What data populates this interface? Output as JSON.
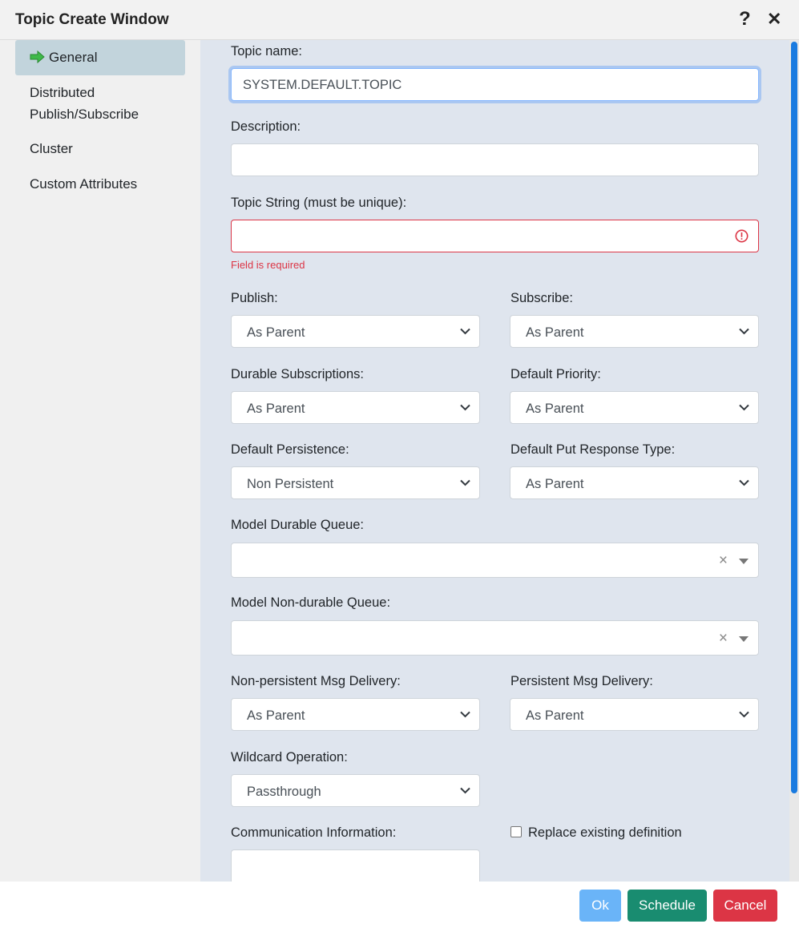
{
  "window": {
    "title": "Topic Create Window"
  },
  "sidebar": {
    "items": [
      {
        "label": "General"
      },
      {
        "label_line1": "Distributed",
        "label_line2": "Publish/Subscribe"
      },
      {
        "label": "Cluster"
      },
      {
        "label": "Custom Attributes"
      }
    ]
  },
  "form": {
    "topic_name": {
      "label": "Topic name:",
      "value": "SYSTEM.DEFAULT.TOPIC"
    },
    "description": {
      "label": "Description:",
      "value": ""
    },
    "topic_string": {
      "label": "Topic String (must be unique):",
      "value": "",
      "error": "Field is required"
    },
    "publish": {
      "label": "Publish:",
      "value": "As Parent"
    },
    "subscribe": {
      "label": "Subscribe:",
      "value": "As Parent"
    },
    "durable_subscriptions": {
      "label": "Durable Subscriptions:",
      "value": "As Parent"
    },
    "default_priority": {
      "label": "Default Priority:",
      "value": "As Parent"
    },
    "default_persistence": {
      "label": "Default Persistence:",
      "value": "Non Persistent"
    },
    "default_put_response_type": {
      "label": "Default Put Response Type:",
      "value": "As Parent"
    },
    "model_durable_queue": {
      "label": "Model Durable Queue:",
      "value": ""
    },
    "model_nondurable_queue": {
      "label": "Model Non-durable Queue:",
      "value": ""
    },
    "nonpersistent_msg_delivery": {
      "label": "Non-persistent Msg Delivery:",
      "value": "As Parent"
    },
    "persistent_msg_delivery": {
      "label": "Persistent Msg Delivery:",
      "value": "As Parent"
    },
    "wildcard_operation": {
      "label": "Wildcard Operation:",
      "value": "Passthrough"
    },
    "communication_information": {
      "label": "Communication Information:",
      "value": ""
    },
    "replace_existing": {
      "label": "Replace existing definition",
      "checked": false
    }
  },
  "footer": {
    "ok": "Ok",
    "schedule": "Schedule",
    "cancel": "Cancel"
  },
  "colors": {
    "ok": "#6ab4f8",
    "schedule": "#198c70",
    "cancel": "#dc3545",
    "active_nav": "#c2d4dc",
    "scrollbar": "#1a7be0",
    "error": "#dc3545"
  }
}
